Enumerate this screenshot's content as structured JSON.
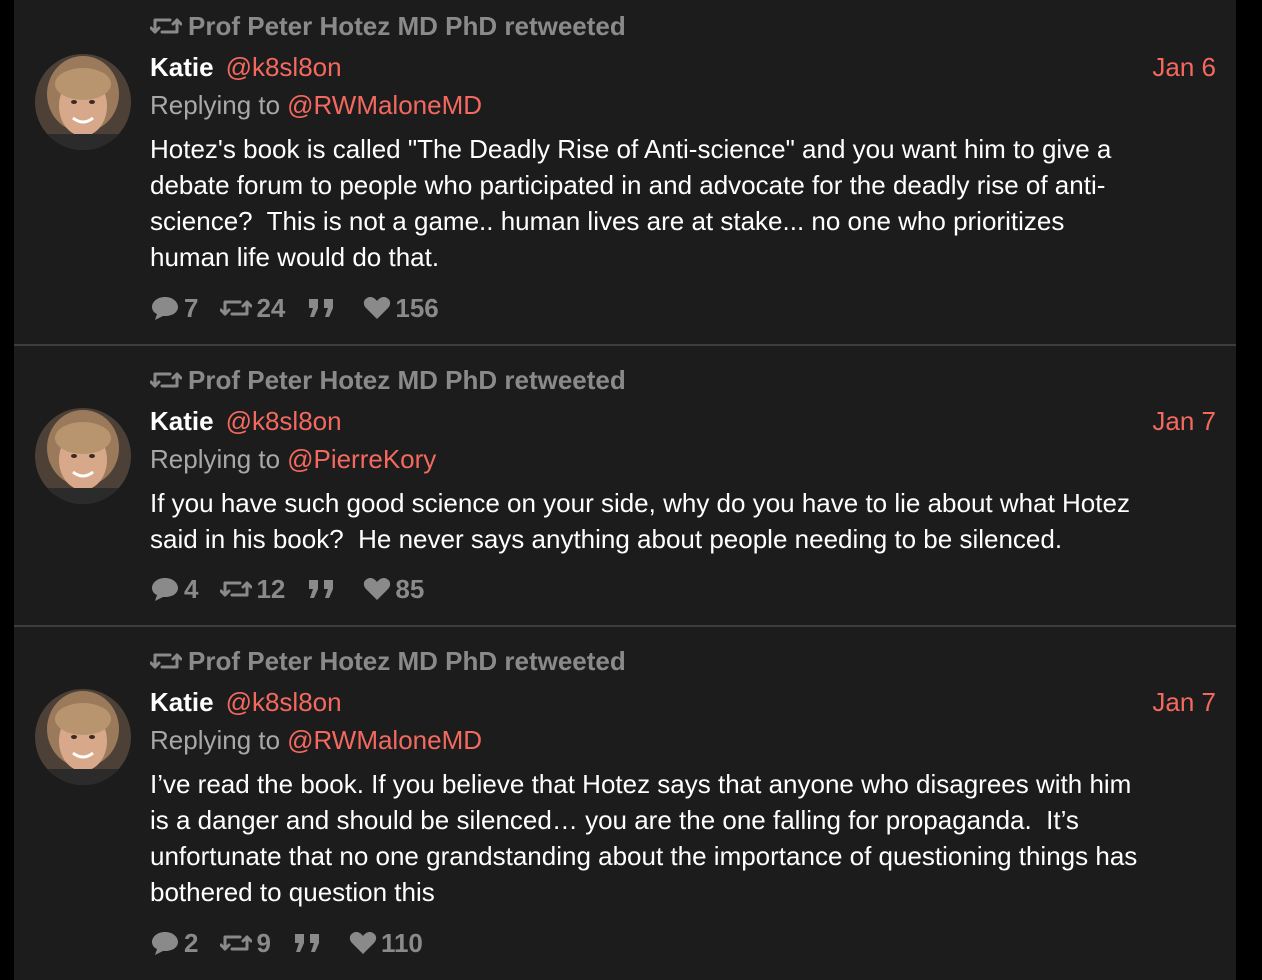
{
  "colors": {
    "background": "#000000",
    "card": "#1c1c1c",
    "accent": "#f4695f",
    "muted": "#8a8a8a",
    "text": "#ffffff"
  },
  "tweets": [
    {
      "retweeted_by": "Prof Peter Hotez MD PhD retweeted",
      "name": "Katie",
      "handle": "@k8sl8on",
      "date": "Jan 6",
      "replying_label": "Replying to",
      "replying_to": "@RWMaloneMD",
      "text": "Hotez's book is called \"The Deadly Rise of Anti-science\" and you want him to give a\ndebate forum to people who participated in and advocate for the deadly rise of anti-\nscience?  This is not a game.. human lives are at stake... no one who prioritizes\nhuman life would do that.",
      "replies": "7",
      "retweets": "24",
      "likes": "156"
    },
    {
      "retweeted_by": "Prof Peter Hotez MD PhD retweeted",
      "name": "Katie",
      "handle": "@k8sl8on",
      "date": "Jan 7",
      "replying_label": "Replying to",
      "replying_to": "@PierreKory",
      "text": "If you have such good science on your side, why do you have to lie about what Hotez\nsaid in his book?  He never says anything about people needing to be silenced.",
      "replies": "4",
      "retweets": "12",
      "likes": "85"
    },
    {
      "retweeted_by": "Prof Peter Hotez MD PhD retweeted",
      "name": "Katie",
      "handle": "@k8sl8on",
      "date": "Jan 7",
      "replying_label": "Replying to",
      "replying_to": "@RWMaloneMD",
      "text": "I’ve read the book. If you believe that Hotez says that anyone who disagrees with him\nis a danger and should be silenced… you are the one falling for propaganda.  It’s\nunfortunate that no one grandstanding about the importance of questioning things has\nbothered to question this",
      "replies": "2",
      "retweets": "9",
      "likes": "110"
    }
  ]
}
